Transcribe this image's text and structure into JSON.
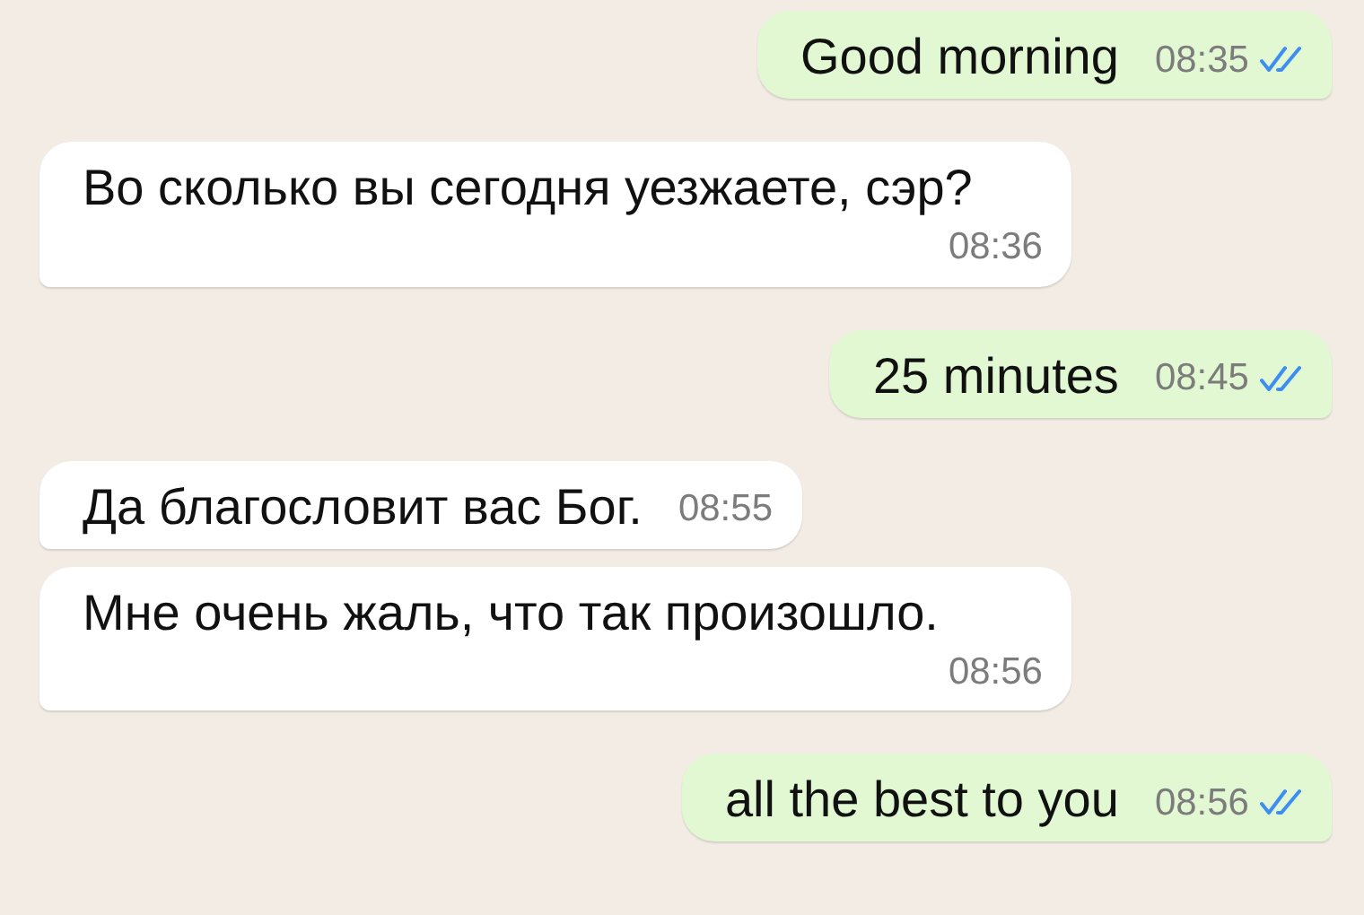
{
  "messages": [
    {
      "kind": "outgoing",
      "text": "Good morning",
      "time": "08:35",
      "read": true
    },
    {
      "kind": "incoming",
      "text": "Во сколько вы сегодня уезжаете, сэр?",
      "time": "08:36"
    },
    {
      "kind": "outgoing",
      "text": "25 minutes",
      "time": "08:45",
      "read": true
    },
    {
      "kind": "incoming",
      "text": "Да благословит вас Бог.",
      "time": "08:55"
    },
    {
      "kind": "incoming",
      "text": "Мне очень жаль, что так произошло.",
      "time": "08:56"
    },
    {
      "kind": "outgoing",
      "text": "all the best to you",
      "time": "08:56",
      "read": true
    }
  ]
}
